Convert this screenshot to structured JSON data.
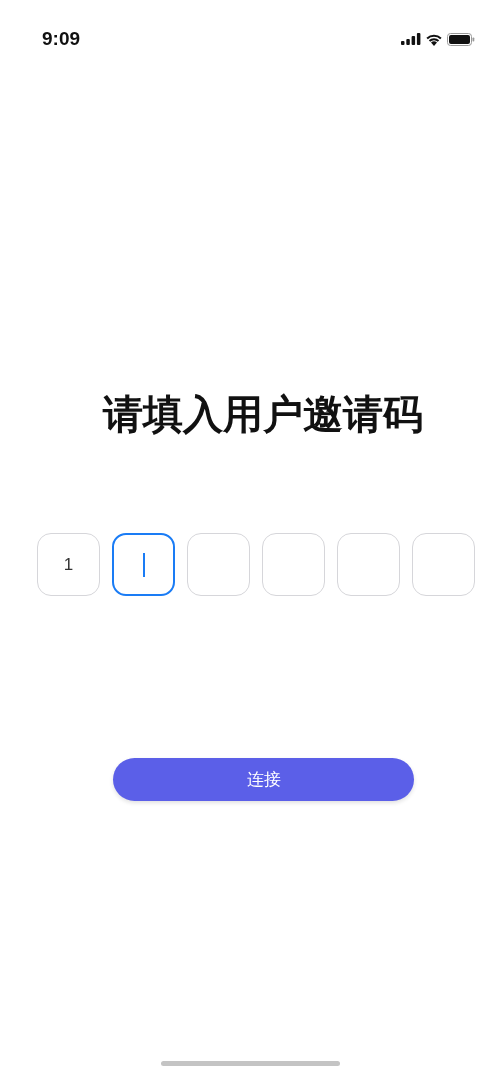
{
  "status_bar": {
    "time": "9:09"
  },
  "title": "请填入用户邀请码",
  "code_cells": [
    {
      "value": "1",
      "selected": false
    },
    {
      "selected": true
    },
    {
      "selected": false
    },
    {
      "selected": false
    },
    {
      "selected": false
    },
    {
      "selected": false
    }
  ],
  "button": {
    "label": "连接"
  }
}
